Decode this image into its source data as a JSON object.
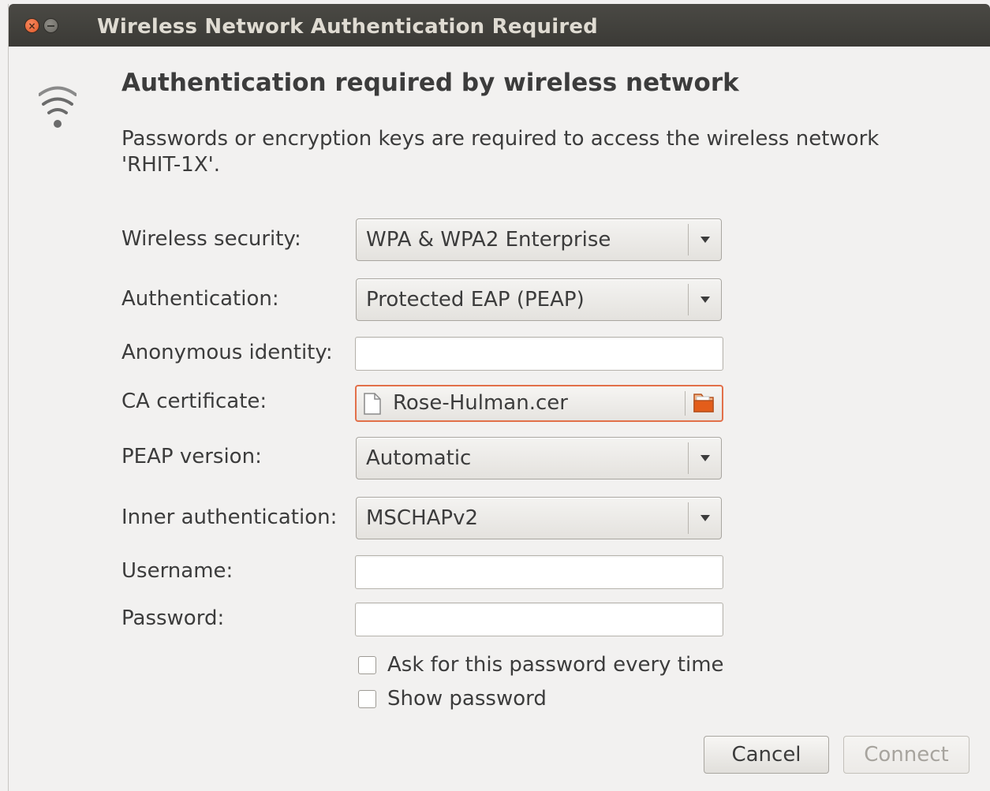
{
  "window": {
    "title": "Wireless Network Authentication Required",
    "close_glyph": "×"
  },
  "dialog": {
    "heading": "Authentication required by wireless network",
    "description": "Passwords or encryption keys are required to access the wireless network 'RHIT-1X'.",
    "icon": "wifi-icon"
  },
  "form": {
    "wireless_security": {
      "label": "Wireless security:",
      "value": "WPA & WPA2 Enterprise"
    },
    "authentication": {
      "label": "Authentication:",
      "value": "Protected EAP (PEAP)"
    },
    "anonymous_identity": {
      "label": "Anonymous identity:",
      "value": ""
    },
    "ca_certificate": {
      "label": "CA certificate:",
      "value": "Rose-Hulman.cer"
    },
    "peap_version": {
      "label": "PEAP version:",
      "value": "Automatic"
    },
    "inner_authentication": {
      "label": "Inner authentication:",
      "value": "MSCHAPv2"
    },
    "username": {
      "label": "Username:",
      "value": ""
    },
    "password": {
      "label": "Password:",
      "value": ""
    },
    "ask_password": {
      "label": "Ask for this password every time",
      "checked": false
    },
    "show_password": {
      "label": "Show password",
      "checked": false
    }
  },
  "buttons": {
    "cancel": "Cancel",
    "connect": "Connect"
  },
  "colors": {
    "titlebar": "#3c3b37",
    "background": "#f2f1f0",
    "focus_accent": "#e2704a",
    "close_button": "#f07746"
  }
}
